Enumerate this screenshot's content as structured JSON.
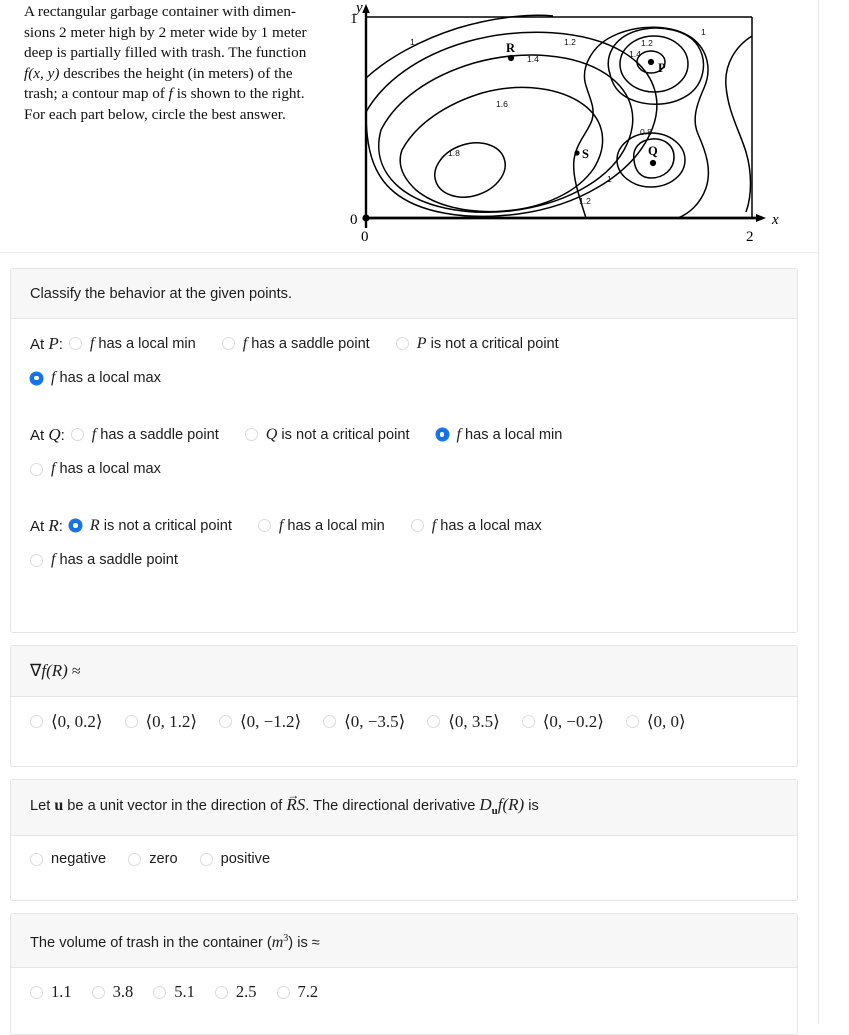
{
  "prompt": {
    "line1": "A rectangular garbage container with dimen-",
    "line2": "sions 2 meter high by 2 meter wide by 1 meter",
    "line3": "deep is partially filled with trash. The function",
    "line4_fxy": "f(x, y)",
    "line4_rest": " describes the height (in meters) of the",
    "line5_a": "trash; a contour map of ",
    "line5_f": "f",
    "line5_b": " is shown to the right.",
    "line6": "For each part below, circle the best answer."
  },
  "figure": {
    "y_axis_label": "y",
    "x_axis_label": "x",
    "y_top_tick": "1",
    "origin_y": "0",
    "origin_x": "0",
    "x_right_tick": "2",
    "points": [
      {
        "name": "P",
        "label": "P"
      },
      {
        "name": "Q",
        "label": "Q"
      },
      {
        "name": "R",
        "label": "R"
      },
      {
        "name": "S",
        "label": "S"
      }
    ],
    "contour_labels": [
      "1",
      "1.2",
      "1.4",
      "1.6",
      "1.8",
      "1.2",
      "1",
      "1.2",
      "1.4",
      "0.8",
      "1",
      "1.2"
    ]
  },
  "chart_data": {
    "type": "contour",
    "title": "",
    "xlabel": "x",
    "ylabel": "y",
    "xlim": [
      0,
      2
    ],
    "ylim": [
      0,
      1
    ],
    "grid": false,
    "contour_levels": [
      0.8,
      1,
      1.2,
      1.4,
      1.6,
      1.8
    ],
    "labeled_contours": [
      {
        "label": "1",
        "x": 0.22,
        "y": 0.83
      },
      {
        "label": "1.2",
        "x": 0.93,
        "y": 0.81
      },
      {
        "label": "1.4",
        "x": 0.72,
        "y": 0.71
      },
      {
        "label": "1.6",
        "x": 0.58,
        "y": 0.51
      },
      {
        "label": "1.8",
        "x": 0.35,
        "y": 0.33
      },
      {
        "label": "1.2",
        "x": 0.91,
        "y": 0.11
      },
      {
        "label": "1",
        "x": 1.14,
        "y": 0.22
      },
      {
        "label": "1.2",
        "x": 1.47,
        "y": 0.83
      },
      {
        "label": "1.4",
        "x": 1.36,
        "y": 0.74
      },
      {
        "label": "1",
        "x": 1.68,
        "y": 0.89
      },
      {
        "label": "0.8",
        "x": 1.45,
        "y": 0.39
      }
    ],
    "critical_points": [
      {
        "name": "P",
        "x": 1.46,
        "y": 0.69,
        "type": "local max",
        "value": 1.4
      },
      {
        "name": "Q",
        "x": 1.42,
        "y": 0.27,
        "type": "local min",
        "value": 0.8
      },
      {
        "name": "R",
        "x": 0.68,
        "y": 0.72,
        "type": "not critical",
        "value": 1.3
      },
      {
        "name": "S",
        "x": 1.01,
        "y": 0.26,
        "type": "not critical",
        "value": 1.1
      }
    ]
  },
  "questions": [
    {
      "id": "classify",
      "header": "Classify the behavior at the given points.",
      "groups": [
        {
          "prefix_at": "At ",
          "prefix_var": "P",
          "prefix_colon": ":",
          "options": [
            {
              "text_pre": "f",
              "text": " has a local min",
              "selected": false
            },
            {
              "text_pre": "f",
              "text": " has a saddle point",
              "selected": false
            },
            {
              "text_pre": "P",
              "text": " is not a critical point",
              "selected": false,
              "upright": true
            },
            {
              "text_pre": "f",
              "text": " has a local max",
              "selected": true
            }
          ]
        },
        {
          "prefix_at": "At ",
          "prefix_var": "Q",
          "prefix_colon": ":",
          "options": [
            {
              "text_pre": "f",
              "text": " has a saddle point",
              "selected": false
            },
            {
              "text_pre": "Q",
              "text": " is not a critical point",
              "selected": false,
              "upright": true
            },
            {
              "text_pre": "f",
              "text": " has a local min",
              "selected": true
            },
            {
              "text_pre": "f",
              "text": " has a local max",
              "selected": false
            }
          ]
        },
        {
          "prefix_at": "At ",
          "prefix_var": "R",
          "prefix_colon": ":",
          "options": [
            {
              "text_pre": "R",
              "text": " is not a critical point",
              "selected": true,
              "upright": true
            },
            {
              "text_pre": "f",
              "text": " has a local min",
              "selected": false
            },
            {
              "text_pre": "f",
              "text": " has a local max",
              "selected": false
            },
            {
              "text_pre": "f",
              "text": " has a saddle point",
              "selected": false
            }
          ]
        }
      ]
    },
    {
      "id": "gradient",
      "header_pre": "∇",
      "header_f": "f",
      "header_arg": "(R)",
      "header_post": " ≈",
      "options": [
        {
          "label": "⟨0, 0.2⟩",
          "selected": false
        },
        {
          "label": "⟨0, 1.2⟩",
          "selected": false
        },
        {
          "label": "⟨0, −1.2⟩",
          "selected": false
        },
        {
          "label": "⟨0, −3.5⟩",
          "selected": false
        },
        {
          "label": "⟨0, 3.5⟩",
          "selected": false
        },
        {
          "label": "⟨0, −0.2⟩",
          "selected": false
        },
        {
          "label": "⟨0, 0⟩",
          "selected": false
        }
      ]
    },
    {
      "id": "directional",
      "header_a": "Let ",
      "header_u": "u",
      "header_b": " be a unit vector in the direction of ",
      "header_rs": "RS",
      "header_c": ". The directional derivative ",
      "header_d": "D",
      "header_usub": "u",
      "header_f": "f",
      "header_arg": "(R)",
      "header_e": " is",
      "options": [
        {
          "label": "negative",
          "selected": false
        },
        {
          "label": "zero",
          "selected": false
        },
        {
          "label": "positive",
          "selected": false
        }
      ]
    },
    {
      "id": "volume",
      "header_a": "The volume of trash in the container (",
      "header_m": "m",
      "header_exp": "3",
      "header_b": ") is ≈",
      "options": [
        {
          "label": "1.1",
          "selected": false
        },
        {
          "label": "3.8",
          "selected": false
        },
        {
          "label": "5.1",
          "selected": false
        },
        {
          "label": "2.5",
          "selected": false
        },
        {
          "label": "7.2",
          "selected": false
        }
      ]
    }
  ],
  "colors": {
    "selected_radio": "#1472e6",
    "card_border": "#e6e6e6",
    "card_header_bg": "#f7f7f7",
    "text": "#1c1c1c"
  }
}
